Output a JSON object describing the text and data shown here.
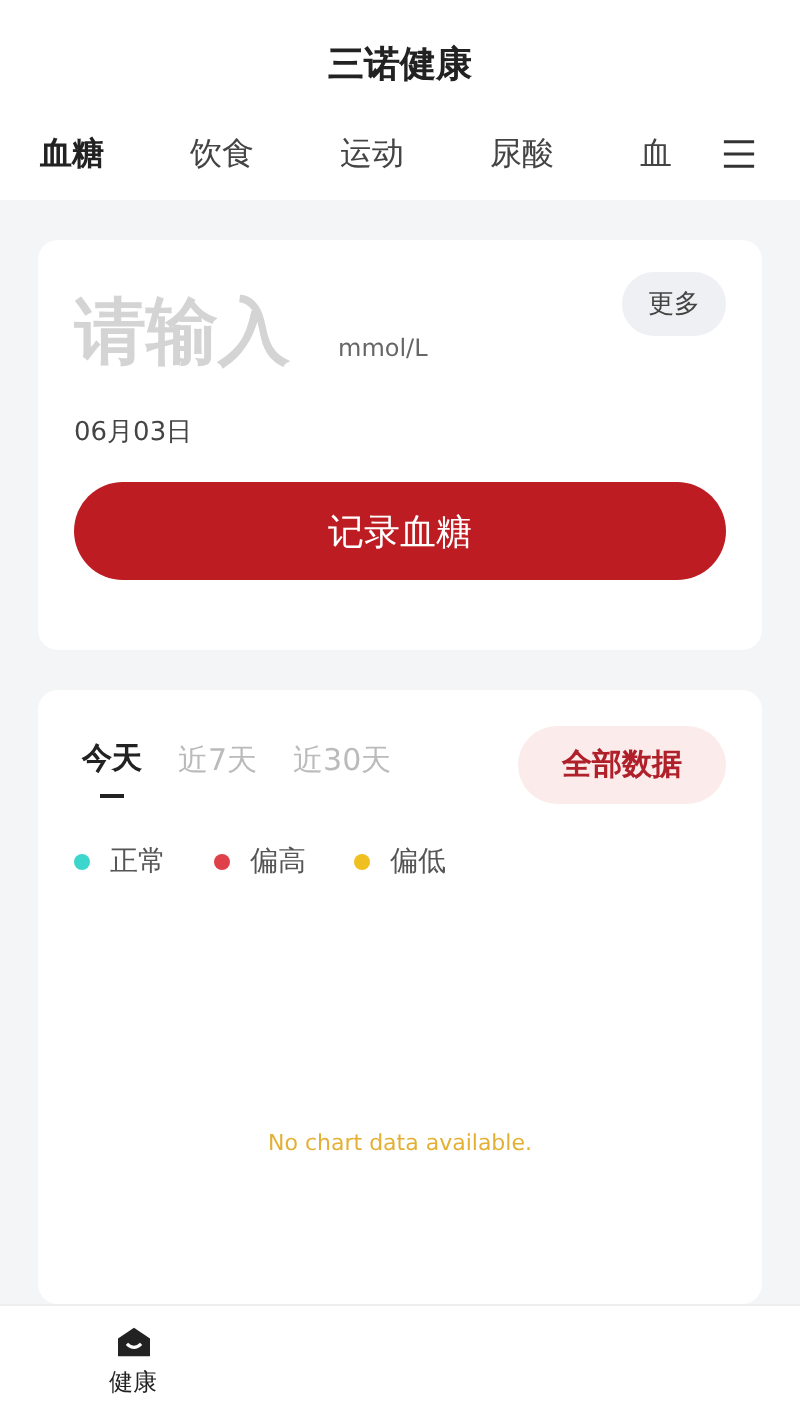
{
  "header": {
    "title": "三诺健康"
  },
  "tabs": [
    {
      "label": "血糖",
      "selected": true
    },
    {
      "label": "饮食",
      "selected": false
    },
    {
      "label": "运动",
      "selected": false
    },
    {
      "label": "尿酸",
      "selected": false
    },
    {
      "label": "血",
      "selected": false
    }
  ],
  "entry": {
    "placeholder": "请输入",
    "unit": "mmol/L",
    "more_button": "更多",
    "date": "06月03日",
    "record_button": "记录血糖"
  },
  "records": {
    "ranges": [
      {
        "label": "今天",
        "selected": true
      },
      {
        "label": "近7天",
        "selected": false
      },
      {
        "label": "近30天",
        "selected": false
      }
    ],
    "all_button": "全部数据",
    "legend": [
      {
        "label": "正常",
        "color": "#3dd6cc"
      },
      {
        "label": "偏高",
        "color": "#e0404a"
      },
      {
        "label": "偏低",
        "color": "#f0c020"
      }
    ],
    "empty_message": "No chart data available."
  },
  "bottom_nav": [
    {
      "label": "健康",
      "selected": true
    }
  ]
}
